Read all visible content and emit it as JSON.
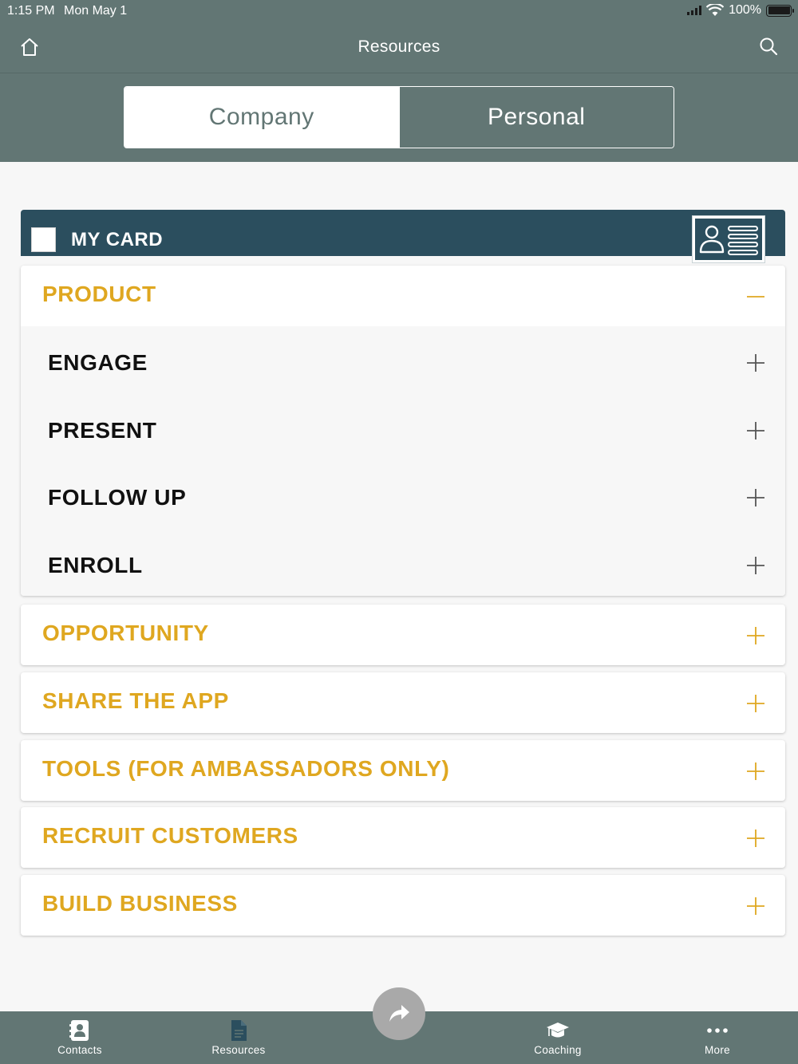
{
  "status_bar": {
    "time": "1:15 PM",
    "date": "Mon May 1",
    "battery": "100%"
  },
  "nav": {
    "title": "Resources"
  },
  "segments": {
    "company": "Company",
    "personal": "Personal",
    "selected": "Company"
  },
  "my_card": {
    "label": "MY CARD"
  },
  "colors": {
    "header": "#627674",
    "card": "#2b4e5e",
    "accent": "#dfa720"
  },
  "product": {
    "title": "PRODUCT",
    "expanded": true,
    "items": [
      {
        "label": "ENGAGE"
      },
      {
        "label": "PRESENT"
      },
      {
        "label": "FOLLOW UP"
      },
      {
        "label": "ENROLL"
      }
    ]
  },
  "sections": [
    {
      "title": "OPPORTUNITY"
    },
    {
      "title": "SHARE THE APP"
    },
    {
      "title": "TOOLS (FOR AMBASSADORS ONLY)"
    },
    {
      "title": "RECRUIT CUSTOMERS"
    },
    {
      "title": "BUILD BUSINESS"
    }
  ],
  "tabbar": {
    "contacts": "Contacts",
    "resources": "Resources",
    "coaching": "Coaching",
    "more": "More"
  }
}
